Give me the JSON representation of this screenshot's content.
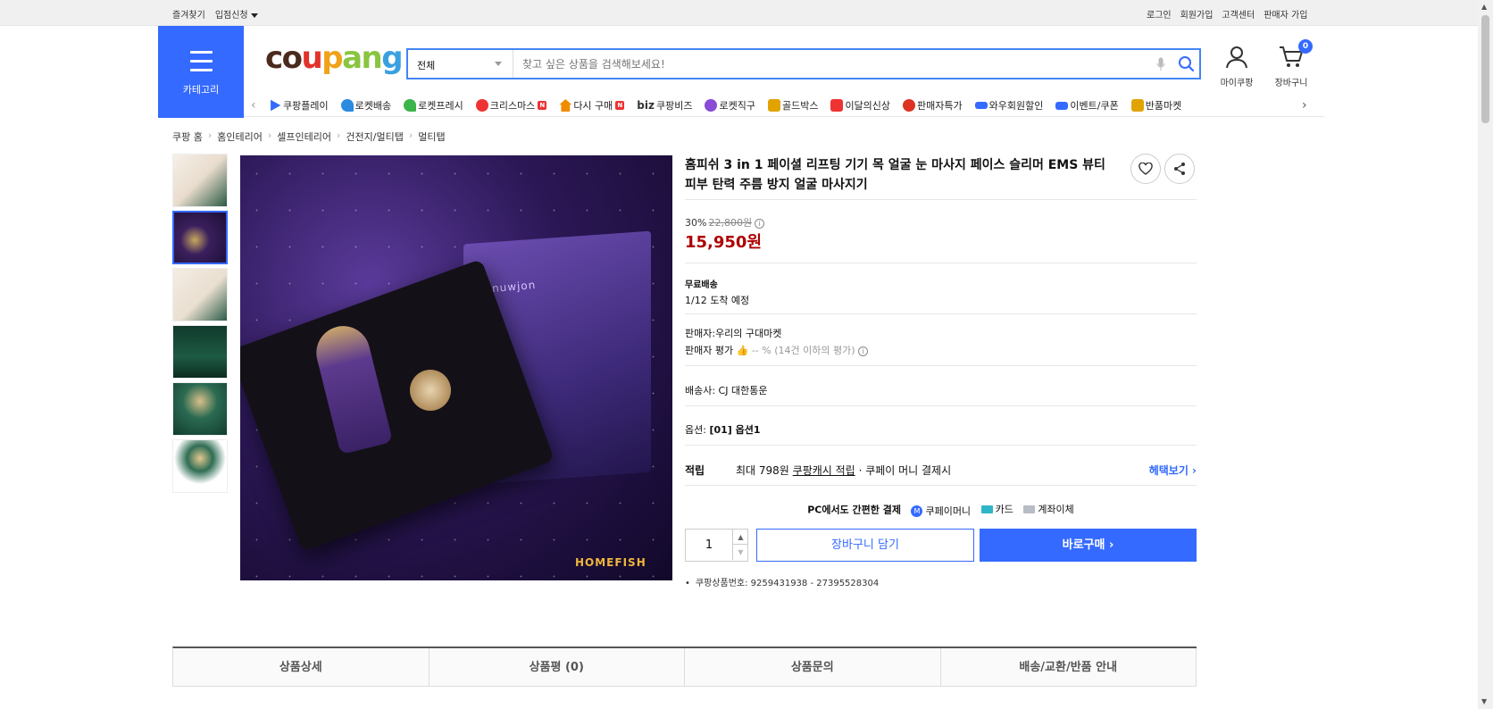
{
  "topbar": {
    "left": [
      "즐겨찾기",
      "입점신청"
    ],
    "right": [
      "로그인",
      "회원가입",
      "고객센터",
      "판매자 가입"
    ]
  },
  "category_button": {
    "label": "카테고리"
  },
  "logo": {
    "parts": [
      "co",
      "u",
      "p",
      "an",
      "g"
    ]
  },
  "search": {
    "category": "전체",
    "placeholder": "찾고 싶은 상품을 검색해보세요!"
  },
  "header_icons": {
    "mycoupang": "마이쿠팡",
    "cart": "장바구니",
    "cart_count": "0"
  },
  "nav": {
    "items": [
      {
        "label": "쿠팡플레이",
        "icon": "play-icon",
        "color": "#346aff",
        "badge": ""
      },
      {
        "label": "로켓배송",
        "icon": "rocket-icon",
        "color": "#2a8be0",
        "badge": ""
      },
      {
        "label": "로켓프레시",
        "icon": "rocket-fresh-icon",
        "color": "#3bb44a",
        "badge": ""
      },
      {
        "label": "크리스마스",
        "icon": "santa-icon",
        "color": "#e33",
        "badge": "N"
      },
      {
        "label": "다시 구매",
        "icon": "home-icon",
        "color": "#f08c00",
        "badge": "N"
      },
      {
        "label": "쿠팡비즈",
        "icon": "biz-icon",
        "color": "#333",
        "badge": ""
      },
      {
        "label": "로켓직구",
        "icon": "rocket-direct-icon",
        "color": "#8a4bd6",
        "badge": ""
      },
      {
        "label": "골드박스",
        "icon": "goldbox-icon",
        "color": "#e0a300",
        "badge": ""
      },
      {
        "label": "이달의신상",
        "icon": "new-icon",
        "color": "#e33",
        "badge": ""
      },
      {
        "label": "판매자특가",
        "icon": "percent-icon",
        "color": "#d32",
        "badge": ""
      },
      {
        "label": "와우회원할인",
        "icon": "wow-icon",
        "color": "#346aff",
        "badge": ""
      },
      {
        "label": "이벤트/쿠폰",
        "icon": "coupon-icon",
        "color": "#346aff",
        "badge": ""
      },
      {
        "label": "반품마켓",
        "icon": "return-market-icon",
        "color": "#e0a300",
        "badge": ""
      }
    ]
  },
  "breadcrumb": [
    "쿠팡 홈",
    "홈인테리어",
    "셀프인테리어",
    "건전지/멀티탭",
    "멀티탭"
  ],
  "product": {
    "title": "홈피쉬 3 in 1 페이셜 리프팅 기기 목 얼굴 눈 마사지 페이스 슬리머 EMS 뷰티 피부 탄력 주름 방지 얼굴 마사지기",
    "discount_rate": "30%",
    "original_price": "22,800원",
    "price": "15,950원",
    "shipping_label": "무료배송",
    "arrival": "1/12 도착 예정",
    "seller": "판매자:우리의 구대마켓",
    "seller_rating_label": "판매자 평가",
    "seller_rating_value": "-- % (14건 이하의 평가)",
    "carrier": "배송사:  CJ 대한통운",
    "option_label": "옵션:",
    "option_value": "[01] 옵션1",
    "reward_key": "적립",
    "reward_prefix": "최대 798원",
    "reward_link": "쿠팡캐시 적립",
    "reward_suffix": "· 쿠페이 머니 결제시",
    "reward_more": "헤택보기 ›",
    "pay_note": "PC에서도 간편한 결제",
    "pay_methods": [
      "쿠페이머니",
      "카드",
      "계좌이체"
    ],
    "quantity": "1",
    "cart_button": "장바구니 담기",
    "buy_button": "바로구매 ›",
    "product_code": "쿠팡상품번호: 9259431938 - 27395528304",
    "image_brand": "HOMEFISH",
    "box_brand": "nuwjon"
  },
  "tabs": [
    "상품상세",
    "상품평 (0)",
    "상품문의",
    "배송/교환/반품 안내"
  ]
}
